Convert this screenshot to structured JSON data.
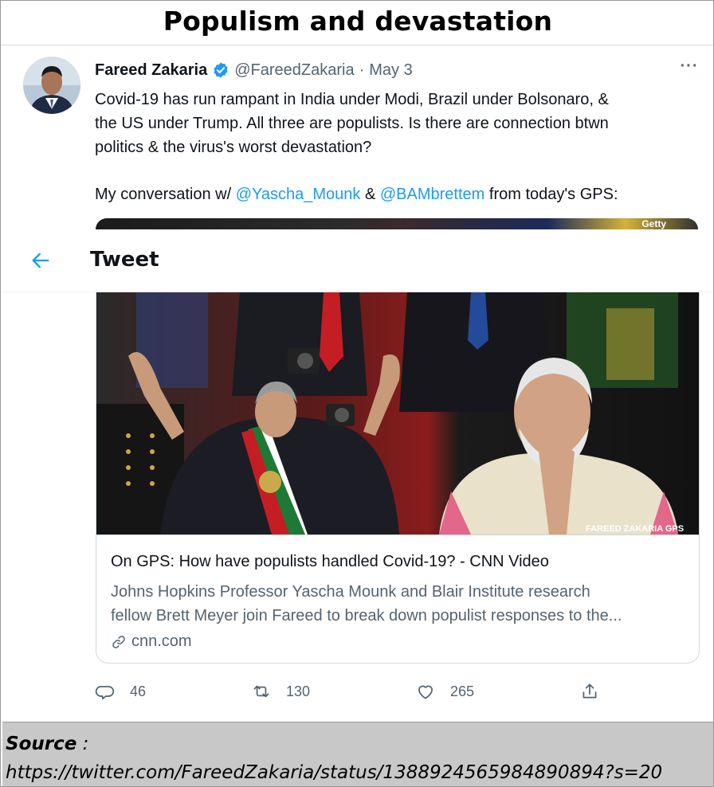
{
  "page": {
    "title": "Populism and devastation"
  },
  "tweet": {
    "author_name": "Fareed Zakaria",
    "handle": "@FareedZakaria",
    "separator": "·",
    "date": "May 3",
    "more_label": "···",
    "text_lines": [
      "Covid-19 has run rampant in India under Modi, Brazil under Bolsonaro, &",
      "the US under Trump. All three are populists. Is there are connection btwn",
      "politics & the virus's worst devastation?"
    ],
    "convo_prefix": "My conversation w/ ",
    "mention_1": "@Yascha_Mounk",
    "convo_and": " & ",
    "mention_2": "@BAMbrettem",
    "convo_suffix": " from today's GPS:",
    "image_credit": "Getty"
  },
  "header": {
    "title": "Tweet"
  },
  "card": {
    "image_watermark": "FAREED ZAKARIA GPS",
    "title": "On GPS: How have populists handled Covid-19? - CNN Video",
    "description_lines": [
      "Johns Hopkins Professor Yascha Mounk and Blair Institute research",
      "fellow Brett Meyer join Fareed to break down populist responses to the..."
    ],
    "domain": "cnn.com"
  },
  "actions": {
    "replies": "46",
    "retweets": "130",
    "likes": "265"
  },
  "source": {
    "label": "Source",
    "colon": " :",
    "url": "https://twitter.com/FareedZakaria/status/1388924565984890894?s=20"
  },
  "colors": {
    "link": "#1d9bf0",
    "muted": "#536471",
    "text": "#0f1419",
    "source_bg": "#c8c8c8"
  }
}
